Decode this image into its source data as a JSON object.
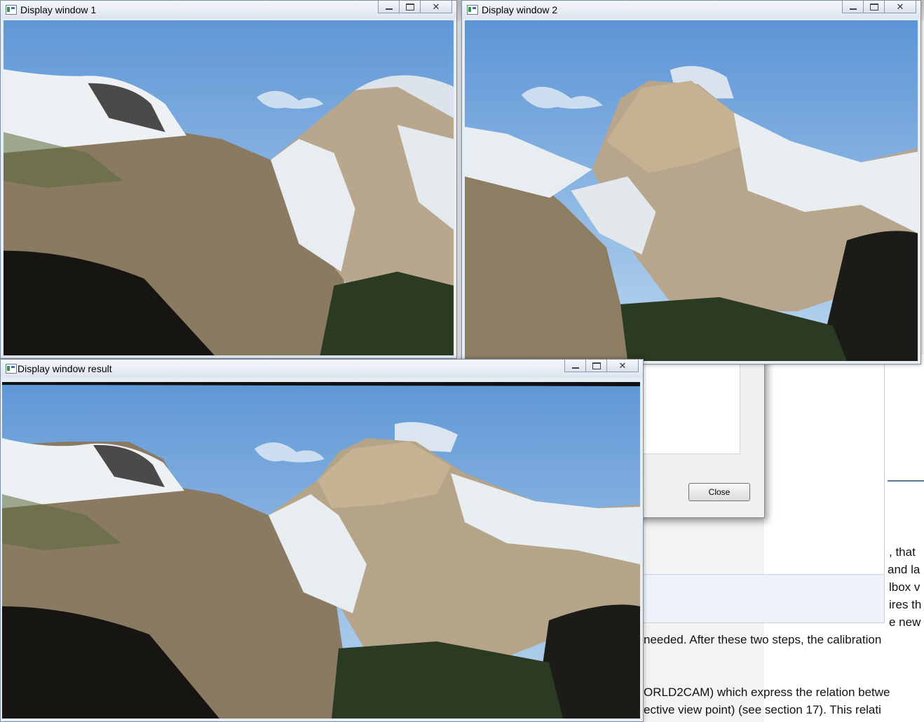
{
  "windows": {
    "win1": {
      "title": "Display window 1"
    },
    "win2": {
      "title": "Display window 2"
    },
    "result": {
      "title": "Display window result"
    }
  },
  "dialog": {
    "close_label": "Close"
  },
  "doc_fragments": [
    ", that",
    "and la",
    "lbox v",
    "ires th",
    "e new",
    "needed. After these two steps, the calibration",
    "ORLD2CAM) which express the relation betwe",
    "ective view point) (see section 17). This relati"
  ],
  "icons": {
    "app": "opencv-window-icon",
    "minimize": "minimize-icon",
    "maximize": "maximize-icon",
    "close": "close-icon"
  }
}
